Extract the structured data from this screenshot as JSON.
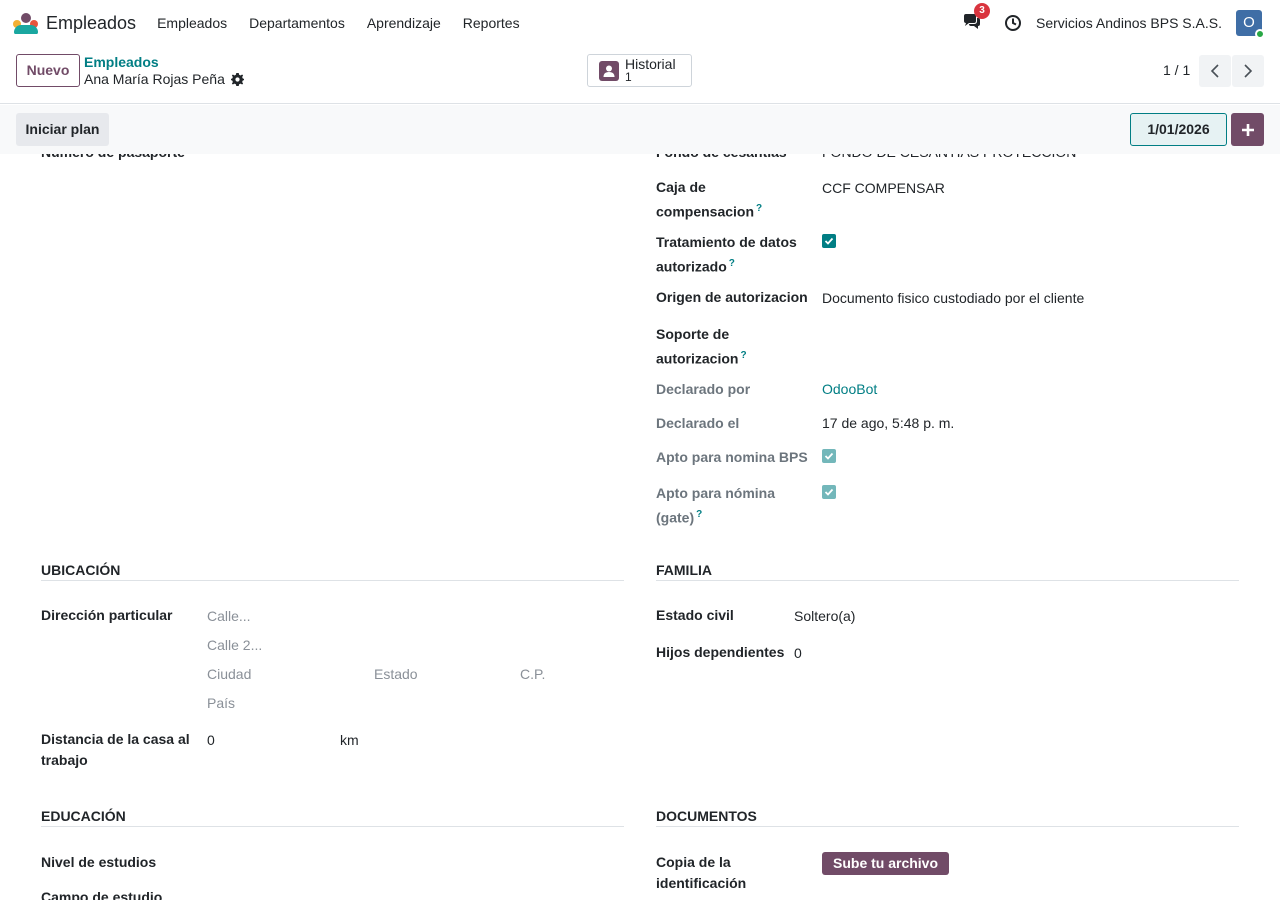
{
  "navbar": {
    "app_name": "Empleados",
    "menu": [
      "Empleados",
      "Departamentos",
      "Aprendizaje",
      "Reportes"
    ],
    "chat_badge": "3",
    "company": "Servicios Andinos BPS S.A.S.",
    "avatar_initial": "O"
  },
  "control": {
    "new_label": "Nuevo",
    "breadcrumb_parent": "Empleados",
    "breadcrumb_current": "Ana María Rojas Peña",
    "historial_label": "Historial",
    "historial_count": "1",
    "pager": "1 / 1"
  },
  "statusbar": {
    "plan_label": "Iniciar plan",
    "date": "1/01/2026"
  },
  "form": {
    "cut_left_label": "Número de pasaporte",
    "cut_right_label": "Fondo de cesantías",
    "cut_right_value": "FONDO DE CESANTIAS PROTECCION",
    "caja_label_1": "Caja de",
    "caja_label_2": "compensacion",
    "caja_value": "CCF COMPENSAR",
    "tratamiento_label_1": "Tratamiento de datos",
    "tratamiento_label_2": "autorizado",
    "tratamiento_checked": true,
    "origen_label": "Origen de autorizacion",
    "origen_value": "Documento fisico custodiado por el cliente",
    "soporte_label_1": "Soporte de",
    "soporte_label_2": "autorizacion",
    "declarado_por_label": "Declarado por",
    "declarado_por_value": "OdooBot",
    "declarado_el_label": "Declarado el",
    "declarado_el_value": "17 de ago, 5:48 p. m.",
    "apto_bps_label": "Apto para nomina BPS",
    "apto_gate_label_1": "Apto para nómina",
    "apto_gate_label_2": "(gate)",
    "help_mark": "?"
  },
  "ubicacion": {
    "title": "UBICACIÓN",
    "direccion_label": "Dirección particular",
    "street_ph": "Calle...",
    "street2_ph": "Calle 2...",
    "city_ph": "Ciudad",
    "state_ph": "Estado",
    "zip_ph": "C.P.",
    "country_ph": "País",
    "distancia_label_1": "Distancia de la casa al",
    "distancia_label_2": "trabajo",
    "distancia_value": "0",
    "distancia_unit": "km"
  },
  "familia": {
    "title": "FAMILIA",
    "estado_civil_label": "Estado civil",
    "estado_civil_value": "Soltero(a)",
    "hijos_label": "Hijos dependientes",
    "hijos_value": "0"
  },
  "educacion": {
    "title": "EDUCACIÓN",
    "nivel_label": "Nivel de estudios",
    "campo_label": "Campo de estudio"
  },
  "documentos": {
    "title": "DOCUMENTOS",
    "copia_label_1": "Copia de la",
    "copia_label_2": "identificación",
    "upload_label": "Sube tu archivo"
  },
  "colors": {
    "brand": "#714B67",
    "accent": "#017E84",
    "badge": "#D9343E"
  }
}
